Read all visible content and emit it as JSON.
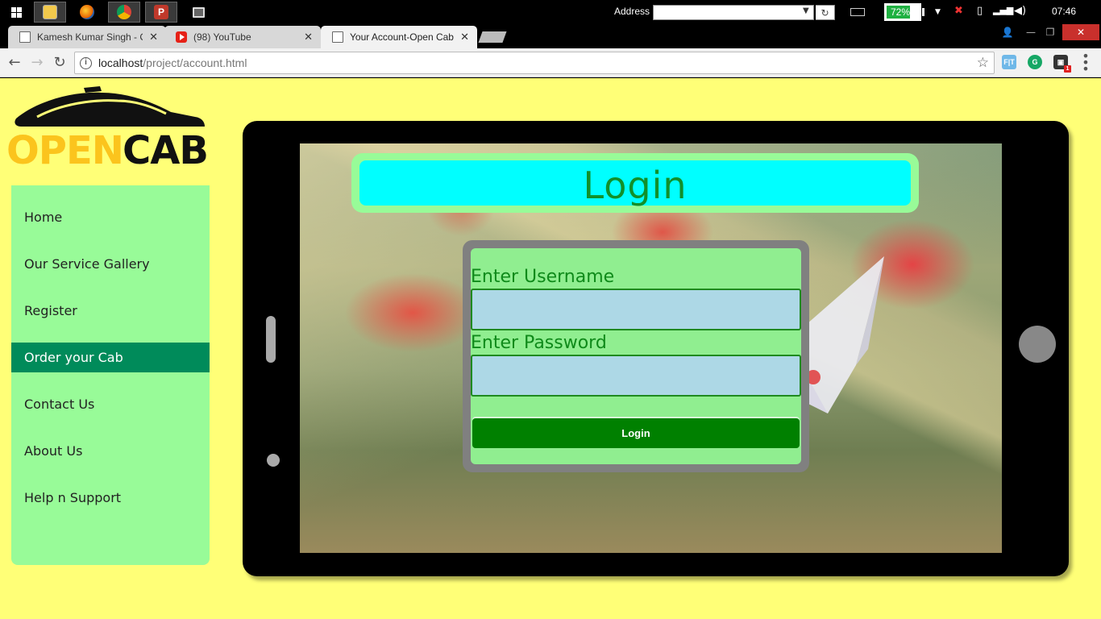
{
  "taskbar": {
    "address_label": "Address",
    "battery": "72%",
    "battery_level": 0.72,
    "clock": "07:46"
  },
  "tabs": [
    {
      "title": "Kamesh Kumar Singh - C",
      "favicon": "doc-icon"
    },
    {
      "title": "(98) YouTube",
      "favicon": "youtube-icon"
    },
    {
      "title": "Your Account-Open Cab",
      "favicon": "doc-icon"
    }
  ],
  "omnibox": {
    "url_host": "localhost",
    "url_path": "/project/account.html"
  },
  "logo": {
    "word1": "OPEN",
    "word2": "CAB"
  },
  "sidebar": {
    "items": [
      {
        "label": "Home",
        "active": false
      },
      {
        "label": "Our Service Gallery",
        "active": false
      },
      {
        "label": "Register",
        "active": false
      },
      {
        "label": "Order your Cab",
        "active": true
      },
      {
        "label": "Contact Us",
        "active": false
      },
      {
        "label": "About Us",
        "active": false
      },
      {
        "label": "Help n Support",
        "active": false
      }
    ]
  },
  "login": {
    "heading": "Login",
    "username_label": "Enter Username",
    "password_label": "Enter Password",
    "username_value": "",
    "password_value": "",
    "submit_label": "Login"
  },
  "colors": {
    "page_bg": "#ffff77",
    "sidebar_bg": "#98fb98",
    "sidebar_active": "#008b5a",
    "header_inner": "#00ffff",
    "form_bg": "#90ee90",
    "input_bg": "#add8e6",
    "button_bg": "#008000",
    "logo_yellow": "#fbc41d"
  }
}
